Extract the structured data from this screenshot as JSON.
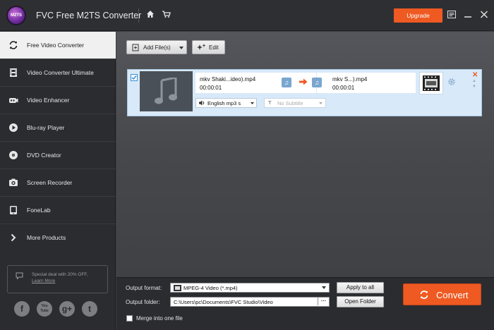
{
  "app": {
    "logo_text": "M2TS",
    "title": "FVC Free M2TS Converter",
    "upgrade_label": "Upgrade"
  },
  "sidebar": {
    "items": [
      {
        "label": "Free Video Converter",
        "icon": "refresh-icon",
        "active": true
      },
      {
        "label": "Video Converter Ultimate",
        "icon": "film-icon",
        "active": false
      },
      {
        "label": "Video Enhancer",
        "icon": "enhancer-icon",
        "active": false
      },
      {
        "label": "Blu-ray Player",
        "icon": "play-icon",
        "active": false
      },
      {
        "label": "DVD Creator",
        "icon": "disc-icon",
        "active": false
      },
      {
        "label": "Screen Recorder",
        "icon": "camera-icon",
        "active": false
      },
      {
        "label": "FoneLab",
        "icon": "phone-icon",
        "active": false
      },
      {
        "label": "More Products",
        "icon": "chevron-right-icon",
        "active": false
      }
    ],
    "deal": {
      "text": "Special deal with 20% OFF,",
      "link": "Learn More"
    },
    "social": [
      "facebook-icon",
      "youtube-icon",
      "google-plus-icon",
      "twitter-icon"
    ],
    "social_glyphs": [
      "f",
      "You Tube",
      "g+",
      "t"
    ]
  },
  "toolbar": {
    "add_files_label": "Add File(s)",
    "edit_label": "Edit"
  },
  "file": {
    "source_name": "mkv Shaki...ideo).mp4",
    "source_duration": "00:00:01",
    "output_name": "mkv S...).mp4",
    "output_duration": "00:00:01",
    "audio_track": "English mp3 s",
    "subtitle": "No Subtitle"
  },
  "bottom": {
    "output_format_label": "Output format:",
    "output_format_value": "MPEG-4 Video (*.mp4)",
    "apply_all_label": "Apply to all",
    "output_folder_label": "Output folder:",
    "output_folder_value": "C:\\Users\\pc\\Documents\\FVC Studio\\Video",
    "browse_label": "···",
    "open_folder_label": "Open Folder",
    "convert_label": "Convert",
    "merge_label": "Merge into one file"
  },
  "colors": {
    "accent": "#ee5a22",
    "sidebar_bg": "#2b2c30",
    "file_row_bg": "#d8e9f9"
  }
}
